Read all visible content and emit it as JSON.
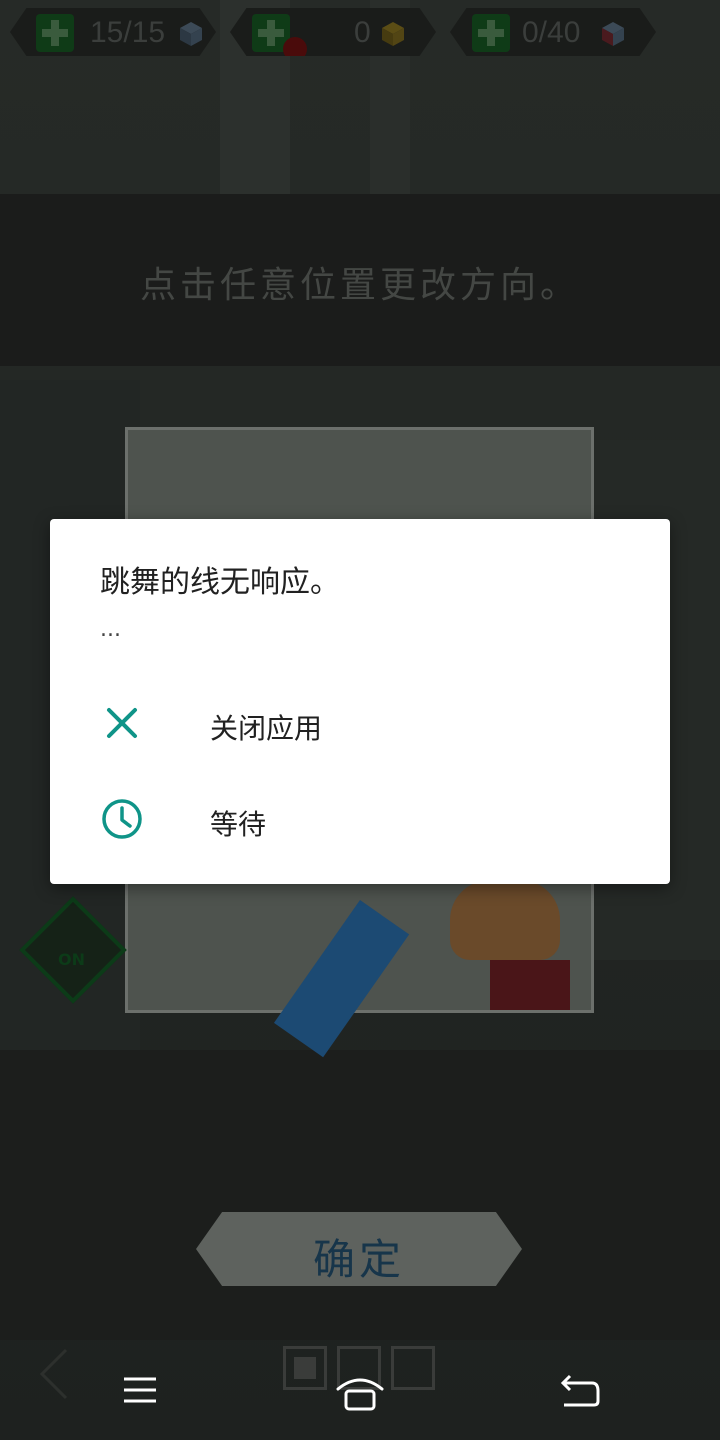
{
  "hud": [
    {
      "value": "15/15"
    },
    {
      "value": "0"
    },
    {
      "value": "0/40"
    }
  ],
  "banner": {
    "text": "点击任意位置更改方向。"
  },
  "tutorial": {
    "on_sign": "ON"
  },
  "confirm": {
    "label": "确定"
  },
  "dialog": {
    "title": "跳舞的线无响应。",
    "subtitle": "...",
    "options": [
      {
        "label": "关闭应用",
        "icon": "close-icon"
      },
      {
        "label": "等待",
        "icon": "clock-icon"
      }
    ],
    "accent": "#0f9488"
  },
  "nav": {
    "icons": [
      "menu-icon",
      "home-icon",
      "back-icon"
    ]
  }
}
